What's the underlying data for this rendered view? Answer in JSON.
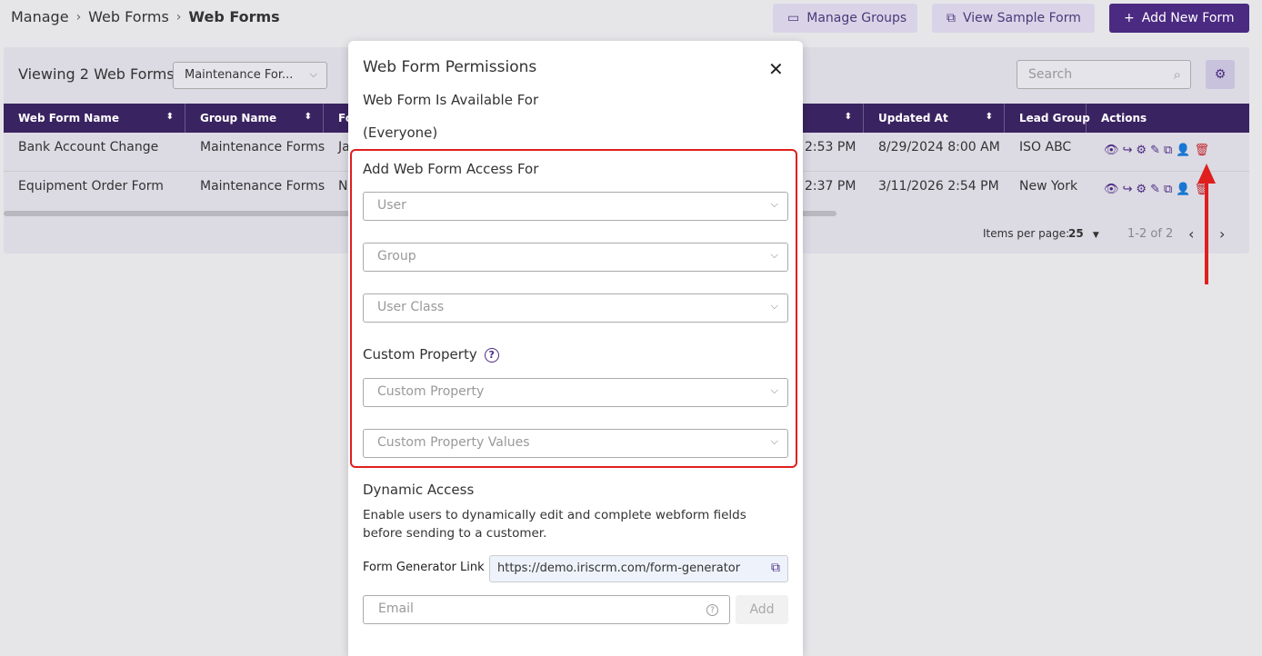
{
  "breadcrumb": {
    "manage": "Manage",
    "web_forms_link": "Web Forms",
    "current": "Web Forms"
  },
  "header_buttons": {
    "manage_groups": "Manage Groups",
    "view_sample": "View Sample Form",
    "add_new": "Add New Form"
  },
  "list": {
    "title": "Viewing 2 Web Forms",
    "filter_value": "Maintenance For...",
    "search_placeholder": "Search"
  },
  "table": {
    "columns": [
      "Web Form Name",
      "Group Name",
      "Fo",
      "Updated At",
      "Lead Group",
      "Actions"
    ],
    "rows": [
      {
        "name": "Bank Account Change",
        "group": "Maintenance Forms",
        "partial": "Ja",
        "created_tail": "2:53 PM",
        "updated": "8/29/2024 8:00 AM",
        "lead_group": "ISO ABC"
      },
      {
        "name": "Equipment Order Form",
        "group": "Maintenance Forms",
        "partial": "N",
        "created_tail": "2:37 PM",
        "updated": "3/11/2026 2:54 PM",
        "lead_group": "New York"
      }
    ]
  },
  "pager": {
    "items_label": "Items per page:",
    "per_page": "25",
    "range": "1-2 of 2"
  },
  "modal": {
    "title": "Web Form Permissions",
    "available_label": "Web Form Is Available For",
    "available_value": "(Everyone)",
    "access_heading": "Add Web Form Access For",
    "user_placeholder": "User",
    "group_placeholder": "Group",
    "user_class_placeholder": "User Class",
    "custom_property_heading": "Custom Property",
    "custom_property_placeholder": "Custom Property",
    "custom_property_values_placeholder": "Custom Property Values",
    "dynamic_heading": "Dynamic Access",
    "dynamic_desc": "Enable users to dynamically edit and complete webform fields before sending to a customer.",
    "generator_label": "Form Generator Link",
    "generator_url": "https://demo.iriscrm.com/form-generator",
    "email_placeholder": "Email",
    "add_label": "Add"
  },
  "colors": {
    "brand": "#4b2a82",
    "header_bg": "#3a2361",
    "annotation": "#e01e1e",
    "delete": "#c0282e"
  }
}
